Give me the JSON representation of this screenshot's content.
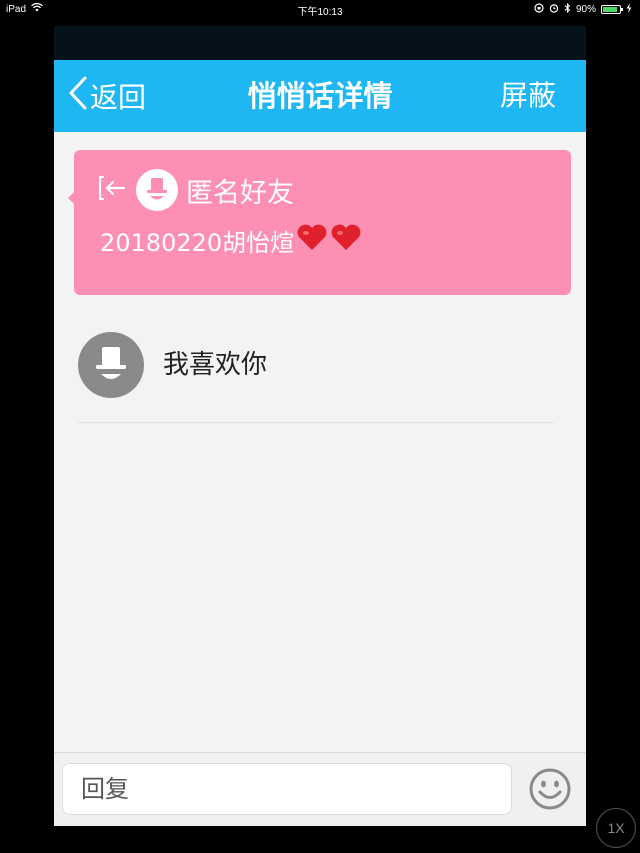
{
  "status_bar": {
    "device": "iPad",
    "time": "下午10:13",
    "battery_percent": "90%",
    "battery_level": 0.9,
    "icons": [
      "wifi-icon",
      "orientation-lock-icon",
      "alarm-icon",
      "bluetooth-icon",
      "battery-icon",
      "charging-icon"
    ]
  },
  "nav": {
    "back_label": "返回",
    "title": "悄悄话详情",
    "action_label": "屏蔽",
    "bar_color": "#1eb6f3"
  },
  "card": {
    "sender": "匿名好友",
    "message": "20180220胡怡煊",
    "hearts": [
      "❤️",
      "❤️"
    ],
    "background_color": "#fd8fb2",
    "icons": [
      "reply-arrow-icon",
      "anonymous-avatar-icon"
    ]
  },
  "message": {
    "text": "我喜欢你",
    "avatar_icon": "anonymous-avatar-icon"
  },
  "reply": {
    "placeholder": "回复",
    "emoji_icon": "smiley-icon"
  },
  "zoom_badge": "1X"
}
